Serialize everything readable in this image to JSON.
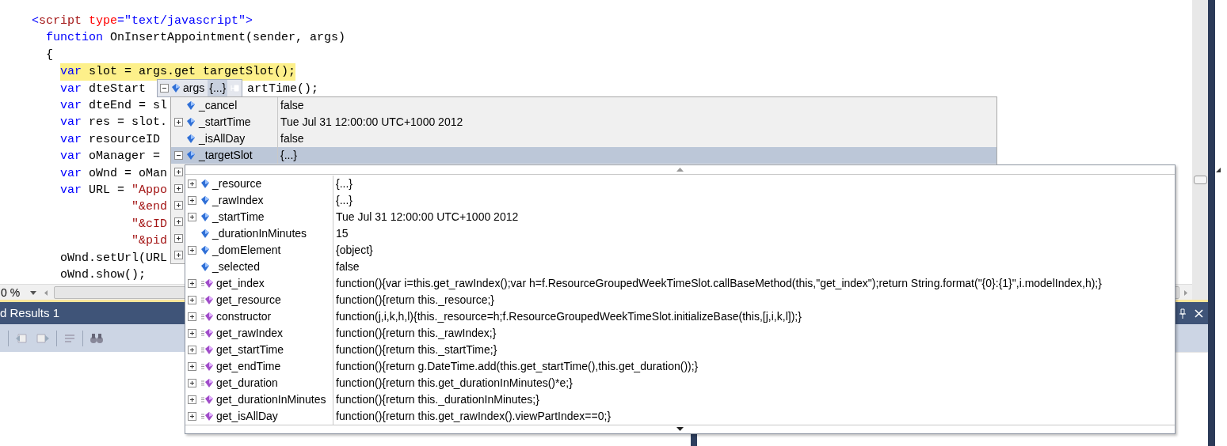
{
  "editor": {
    "code_lines": [
      {
        "highlighted": false,
        "segments": [
          [
            {
              "kind": "punct",
              "text": "<"
            },
            {
              "kind": "tag",
              "text": "script"
            },
            {
              "kind": "attr",
              "text": " type"
            },
            {
              "kind": "punct",
              "text": "=\"text/javascript\">"
            }
          ]
        ]
      },
      {
        "highlighted": false,
        "segments": [
          [
            {
              "kind": "kw",
              "text": "  function"
            },
            {
              "kind": "plain",
              "text": " OnInsertAppointment(sender, args)"
            }
          ]
        ]
      },
      {
        "highlighted": false,
        "segments": [
          [
            {
              "kind": "plain",
              "text": "  {"
            }
          ]
        ]
      },
      {
        "highlighted": true,
        "segments": [
          [
            {
              "kind": "kw",
              "text": "var"
            },
            {
              "kind": "plain",
              "text": " slot = args.get targetSlot();"
            }
          ]
        ]
      },
      {
        "highlighted": false,
        "segments": [
          [
            {
              "kind": "kw",
              "text": "    var"
            },
            {
              "kind": "plain",
              "text": " dteStart"
            }
          ],
          [
            {
              "kind": "plain",
              "text": "artTime();"
            }
          ]
        ]
      },
      {
        "highlighted": false,
        "segments": [
          [
            {
              "kind": "kw",
              "text": "    var"
            },
            {
              "kind": "plain",
              "text": " dteEnd = sl"
            }
          ]
        ]
      },
      {
        "highlighted": false,
        "segments": [
          [
            {
              "kind": "kw",
              "text": "    var"
            },
            {
              "kind": "plain",
              "text": " res = slot."
            }
          ]
        ]
      },
      {
        "highlighted": false,
        "segments": [
          [
            {
              "kind": "kw",
              "text": "    var"
            },
            {
              "kind": "plain",
              "text": " resourceID"
            }
          ]
        ]
      },
      {
        "highlighted": false,
        "segments": [
          [
            {
              "kind": "kw",
              "text": "    var"
            },
            {
              "kind": "plain",
              "text": " oManager ="
            }
          ]
        ]
      },
      {
        "highlighted": false,
        "segments": [
          [
            {
              "kind": "kw",
              "text": "    var"
            },
            {
              "kind": "plain",
              "text": " oWnd = oMan"
            }
          ]
        ]
      },
      {
        "highlighted": false,
        "segments": [
          [
            {
              "kind": "kw",
              "text": "    var"
            },
            {
              "kind": "plain",
              "text": " URL = "
            },
            {
              "kind": "str",
              "text": "\"Appo"
            }
          ]
        ]
      },
      {
        "highlighted": false,
        "segments": [
          [
            {
              "kind": "str",
              "text": "              \"&end"
            }
          ]
        ]
      },
      {
        "highlighted": false,
        "segments": [
          [
            {
              "kind": "str",
              "text": "              \"&cID"
            }
          ]
        ]
      },
      {
        "highlighted": false,
        "segments": [
          [
            {
              "kind": "str",
              "text": "              \"&pid"
            }
          ]
        ]
      },
      {
        "highlighted": false,
        "segments": [
          [
            {
              "kind": "plain",
              "text": "    oWnd.setUrl(URL"
            }
          ]
        ]
      },
      {
        "highlighted": false,
        "segments": [
          [
            {
              "kind": "plain",
              "text": "    oWnd.show();"
            }
          ]
        ]
      }
    ],
    "zoom": "0 %"
  },
  "results_panel": {
    "title": "d Results 1"
  },
  "datatip": {
    "name": "args",
    "value": "{...}",
    "expanded": true
  },
  "datatip_rows": [
    {
      "kind": "field",
      "name": "_cancel",
      "value": "false",
      "expandable": false,
      "selected": false
    },
    {
      "kind": "field",
      "name": "_startTime",
      "value": "Tue Jul 31 12:00:00 UTC+1000 2012",
      "expandable": true,
      "expanded": false,
      "selected": false
    },
    {
      "kind": "field",
      "name": "_isAllDay",
      "value": "false",
      "expandable": false,
      "selected": false
    },
    {
      "kind": "field",
      "name": "_targetSlot",
      "value": "{...}",
      "expandable": true,
      "expanded": true,
      "selected": true
    }
  ],
  "covered_rows": [
    {
      "expandable": true
    },
    {
      "expandable": true
    },
    {
      "expandable": true
    },
    {
      "expandable": true
    },
    {
      "expandable": true
    },
    {
      "expandable": true
    }
  ],
  "child_rows": [
    {
      "kind": "field",
      "name": "_resource",
      "value": "{...}",
      "expandable": true
    },
    {
      "kind": "field",
      "name": "_rawIndex",
      "value": "{...}",
      "expandable": true
    },
    {
      "kind": "field",
      "name": "_startTime",
      "value": "Tue Jul 31 12:00:00 UTC+1000 2012",
      "expandable": true
    },
    {
      "kind": "field",
      "name": "_durationInMinutes",
      "value": "15",
      "expandable": false
    },
    {
      "kind": "field",
      "name": "_domElement",
      "value": "{object}",
      "expandable": true
    },
    {
      "kind": "field",
      "name": "_selected",
      "value": "false",
      "expandable": false
    },
    {
      "kind": "method",
      "name": "get_index",
      "value": "function(){var i=this.get_rawIndex();var h=f.ResourceGroupedWeekTimeSlot.callBaseMethod(this,\"get_index\");return String.format(\"{0}:{1}\",i.modelIndex,h);}",
      "expandable": true
    },
    {
      "kind": "method",
      "name": "get_resource",
      "value": "function(){return this._resource;}",
      "expandable": true
    },
    {
      "kind": "method",
      "name": "constructor",
      "value": "function(j,i,k,h,l){this._resource=h;f.ResourceGroupedWeekTimeSlot.initializeBase(this,[j,i,k,l]);}",
      "expandable": true
    },
    {
      "kind": "method",
      "name": "get_rawIndex",
      "value": "function(){return this._rawIndex;}",
      "expandable": true
    },
    {
      "kind": "method",
      "name": "get_startTime",
      "value": "function(){return this._startTime;}",
      "expandable": true
    },
    {
      "kind": "method",
      "name": "get_endTime",
      "value": "function(){return g.DateTime.add(this.get_startTime(),this.get_duration());}",
      "expandable": true
    },
    {
      "kind": "method",
      "name": "get_duration",
      "value": "function(){return this.get_durationInMinutes()*e;}",
      "expandable": true
    },
    {
      "kind": "method",
      "name": "get_durationInMinutes",
      "value": "function(){return this._durationInMinutes;}",
      "expandable": true
    },
    {
      "kind": "method",
      "name": "get_isAllDay",
      "value": "function(){return this.get_rawIndex().viewPartIndex==0;}",
      "expandable": true
    }
  ]
}
